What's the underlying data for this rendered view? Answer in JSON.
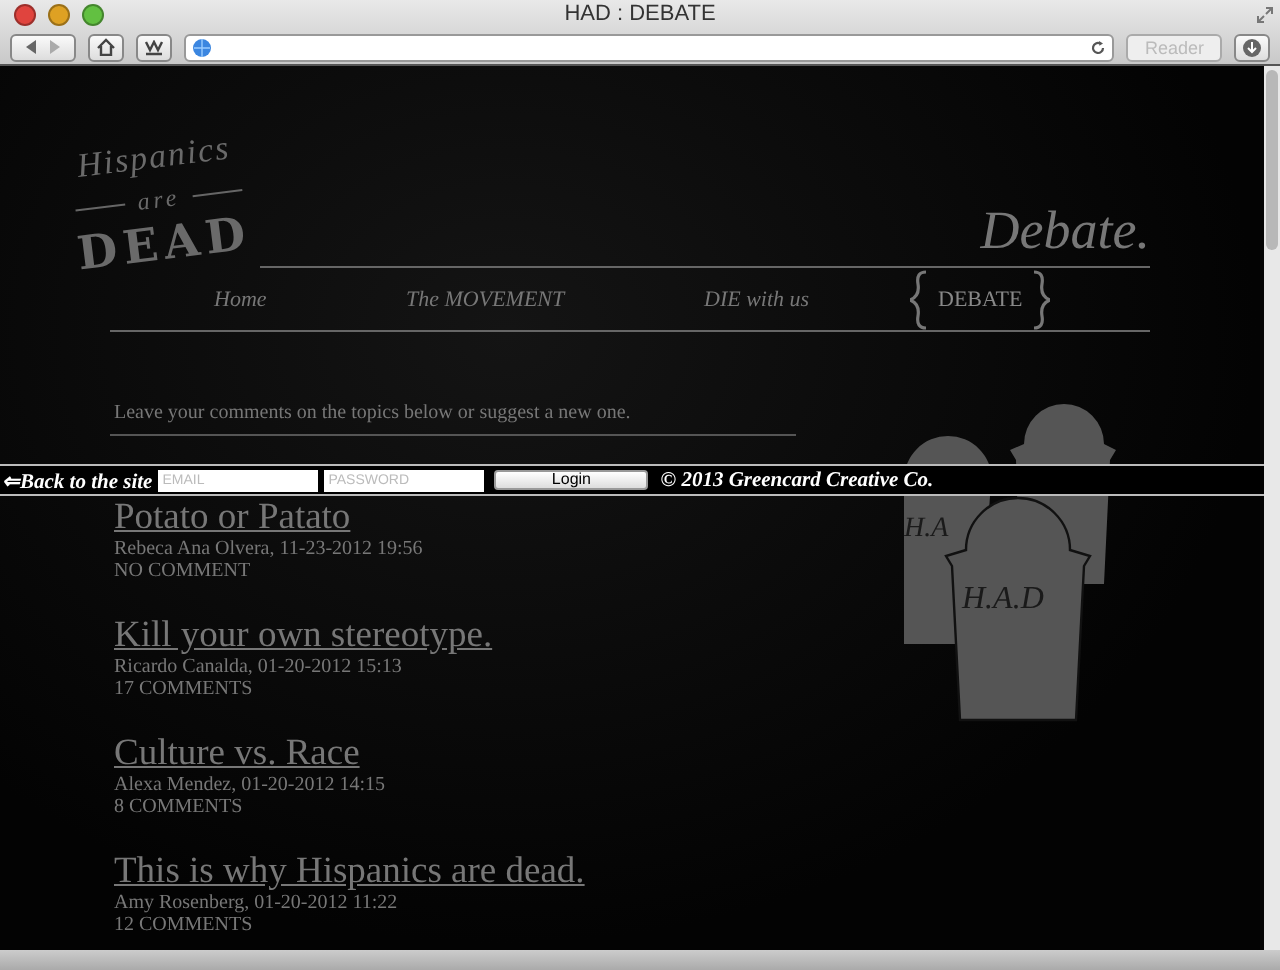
{
  "window": {
    "title": "HAD : DEBATE"
  },
  "toolbar": {
    "reader_button": {
      "label": "Reader",
      "disabled": true
    }
  },
  "logo": {
    "line_1": "Hispanics",
    "line_2": "are",
    "line_3": "DEAD"
  },
  "page_title": "Debate.",
  "nav": [
    {
      "label": "Home",
      "selected": false
    },
    {
      "label": "The MOVEMENT",
      "selected": false
    },
    {
      "label": "DIE with us",
      "selected": false
    },
    {
      "label": "DEBATE",
      "selected": true
    }
  ],
  "intro": "Leave your comments on the topics below or suggest a new one.",
  "login_bar": {
    "back_link": "⇐Back to the site",
    "email": {
      "placeholder": "EMAIL"
    },
    "password": {
      "placeholder": "PASSWORD"
    },
    "login_button": "Login",
    "copyright": "© 2013 Greencard Creative Co."
  },
  "tombstone_labels": [
    "H.A",
    "H.A.D"
  ],
  "posts": [
    {
      "title": "Potato or Patato",
      "meta": "Rebeca Ana Olvera, 11-23-2012 19:56",
      "comments": "NO COMMENT"
    },
    {
      "title": "Kill your own stereotype.",
      "meta": "Ricardo Canalda, 01-20-2012 15:13",
      "comments": "17 COMMENTS"
    },
    {
      "title": "Culture vs. Race",
      "meta": "Alexa Mendez, 01-20-2012 14:15",
      "comments": "8 COMMENTS"
    },
    {
      "title": "This is why Hispanics are dead.",
      "meta": "Amy Rosenberg, 01-20-2012 11:22",
      "comments": "12 COMMENTS"
    }
  ]
}
